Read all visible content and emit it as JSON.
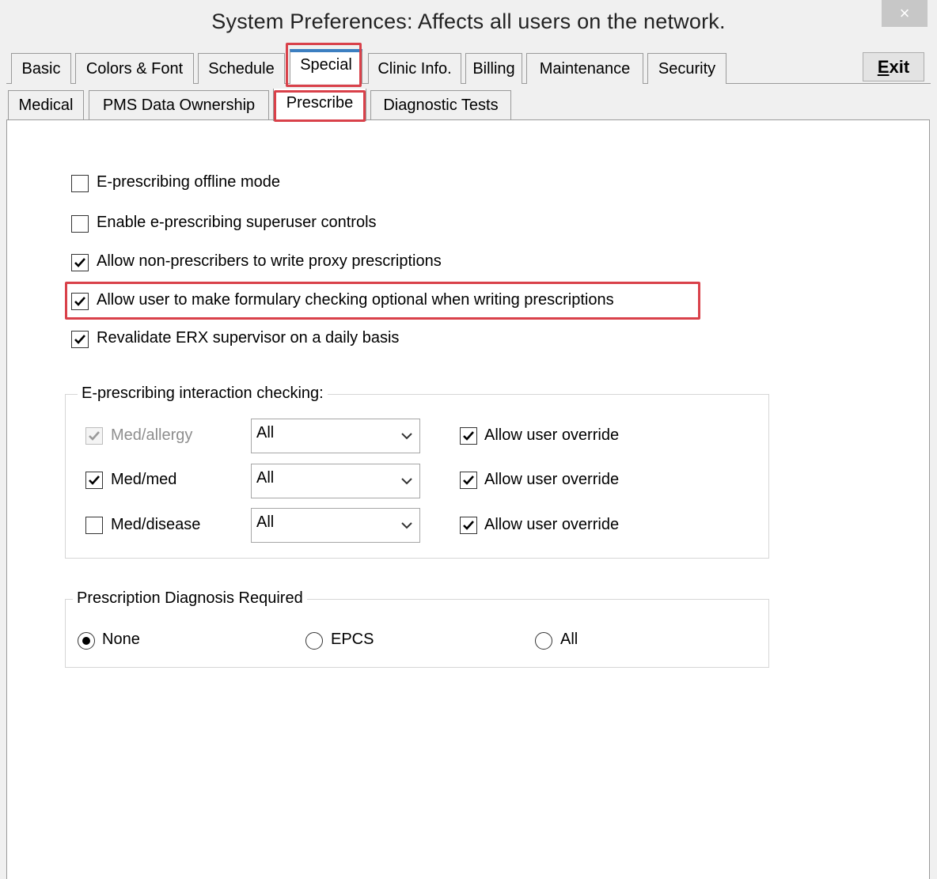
{
  "window": {
    "title": "System Preferences: Affects all users on the network.",
    "close_glyph": "×"
  },
  "tabs_row1": [
    "Basic",
    "Colors & Font",
    "Schedule",
    "Special",
    "Clinic Info.",
    "Billing",
    "Maintenance",
    "Security"
  ],
  "tabs_row2": [
    "Medical",
    "PMS Data Ownership",
    "Prescribe",
    "Diagnostic Tests"
  ],
  "active_tab_row1": "Special",
  "active_tab_row2": "Prescribe",
  "exit_button": {
    "label_underlined": "E",
    "label_rest": "xit"
  },
  "options": [
    {
      "label": "E-prescribing offline mode",
      "checked": false
    },
    {
      "label": "Enable e-prescribing superuser controls",
      "checked": false
    },
    {
      "label": "Allow non-prescribers to write proxy prescriptions",
      "checked": true
    },
    {
      "label": "Allow user to make formulary checking optional when writing prescriptions",
      "checked": true
    },
    {
      "label": "Revalidate ERX supervisor on a daily basis",
      "checked": true
    }
  ],
  "interaction_group": {
    "title": "E-prescribing interaction checking:",
    "rows": [
      {
        "label": "Med/allergy",
        "checked": true,
        "disabled": true,
        "level": "All",
        "override_label": "Allow user override",
        "override_checked": true
      },
      {
        "label": "Med/med",
        "checked": true,
        "disabled": false,
        "level": "All",
        "override_label": "Allow user override",
        "override_checked": true
      },
      {
        "label": "Med/disease",
        "checked": false,
        "disabled": false,
        "level": "All",
        "override_label": "Allow user override",
        "override_checked": true
      }
    ]
  },
  "diagnosis_group": {
    "title": "Prescription Diagnosis Required",
    "options": [
      {
        "label": "None",
        "selected": true
      },
      {
        "label": "EPCS",
        "selected": false
      },
      {
        "label": "All",
        "selected": false
      }
    ]
  },
  "highlight_color": "#d9414a",
  "active_tab_accent": "#3c7fc1"
}
